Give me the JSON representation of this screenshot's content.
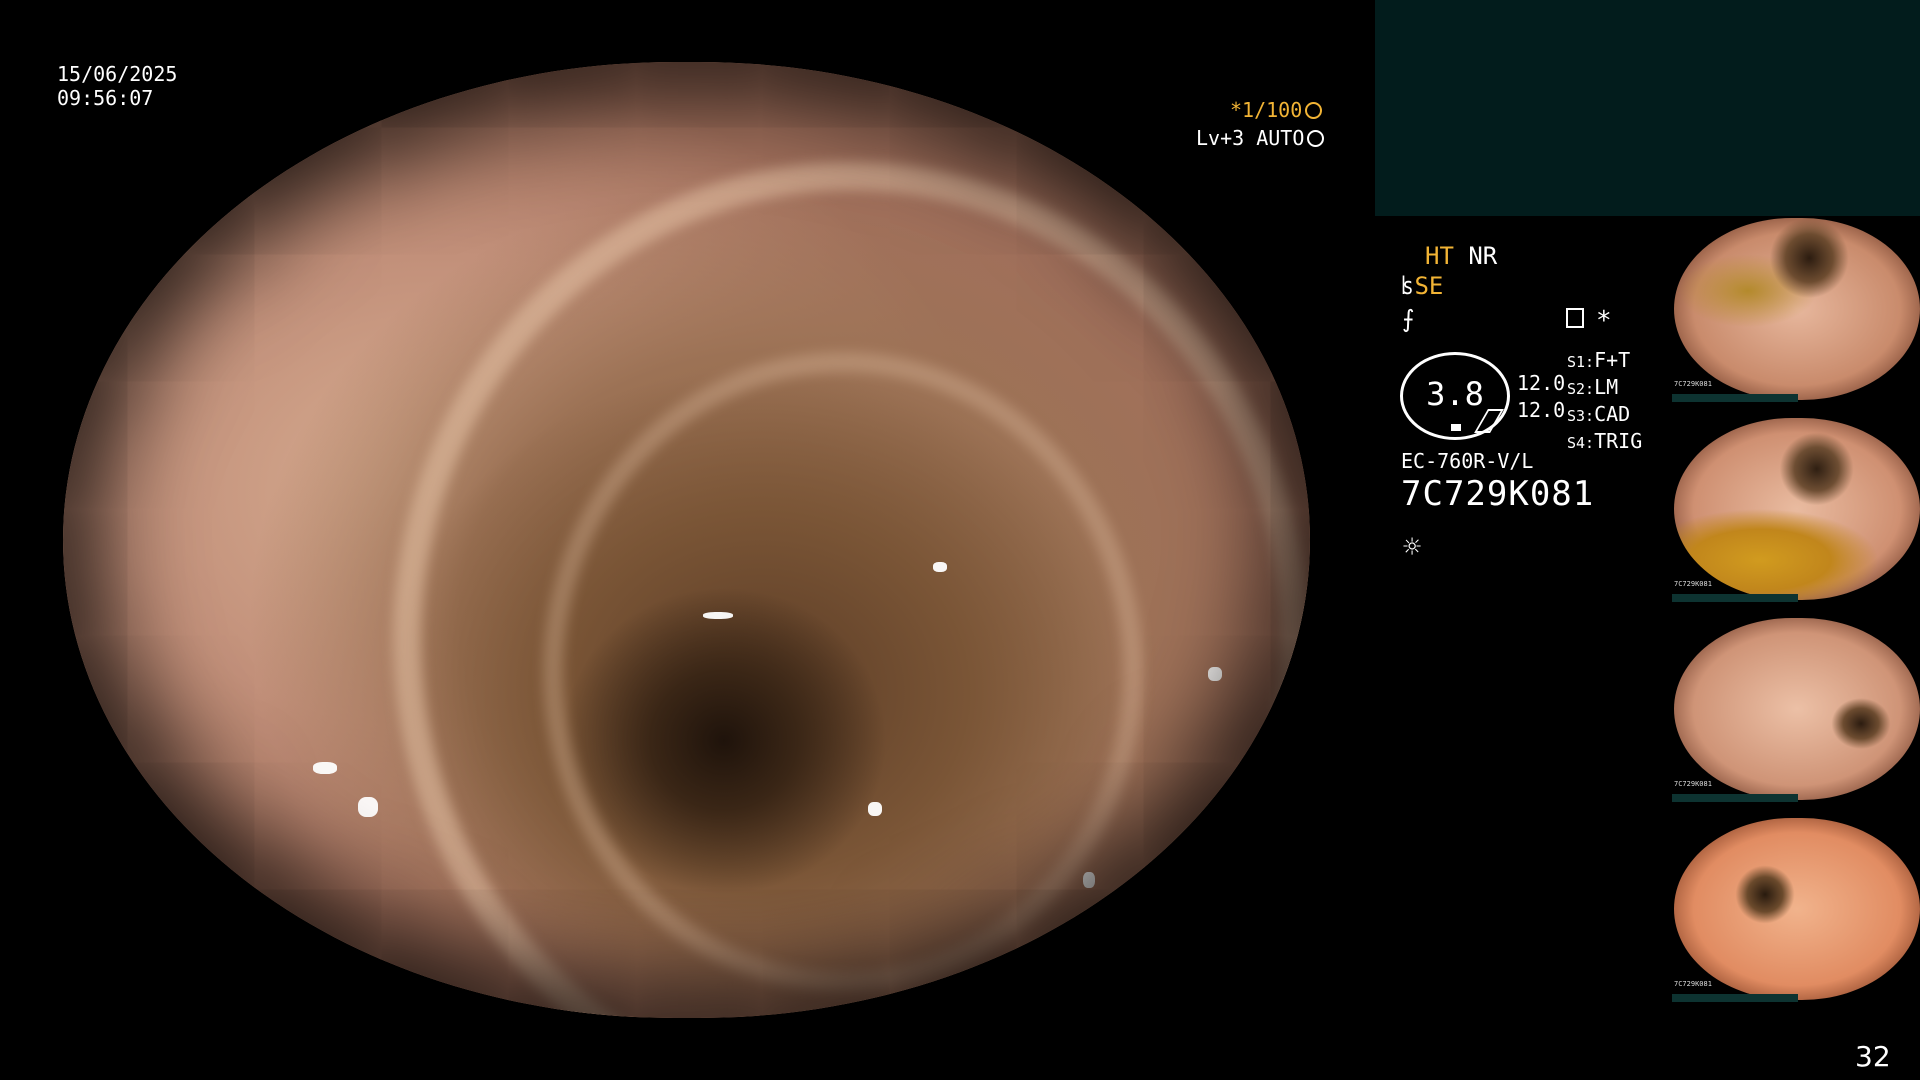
{
  "overlay": {
    "date": "15/06/2025",
    "time": "09:56:07",
    "zoom": "*1/100",
    "level": "Lv+3 AUTO"
  },
  "panel": {
    "ht": "HT",
    "nr": "NR",
    "se": "SE",
    "gauge_value": "3.8",
    "values": [
      "12.0",
      "12.0"
    ],
    "slots": [
      {
        "key": "S1:",
        "label": "F+T"
      },
      {
        "key": "S2:",
        "label": "LM"
      },
      {
        "key": "S3:",
        "label": "CAD"
      },
      {
        "key": "S4:",
        "label": "TRIG"
      }
    ],
    "model": "EC-760R-V/L",
    "serial": "7C729K081"
  },
  "thumbnails": [
    {
      "caption": "7C729K081"
    },
    {
      "caption": "7C729K081"
    },
    {
      "caption": "7C729K081"
    },
    {
      "caption": "7C729K081"
    }
  ],
  "icons": [
    "scope-icon",
    "wave-icon",
    "memory-icon",
    "brightness-icon",
    "zoom-icon",
    "auto-icon"
  ],
  "colors": {
    "accent": "#f2b435",
    "panel": "#021c1c"
  },
  "page_number": "32"
}
